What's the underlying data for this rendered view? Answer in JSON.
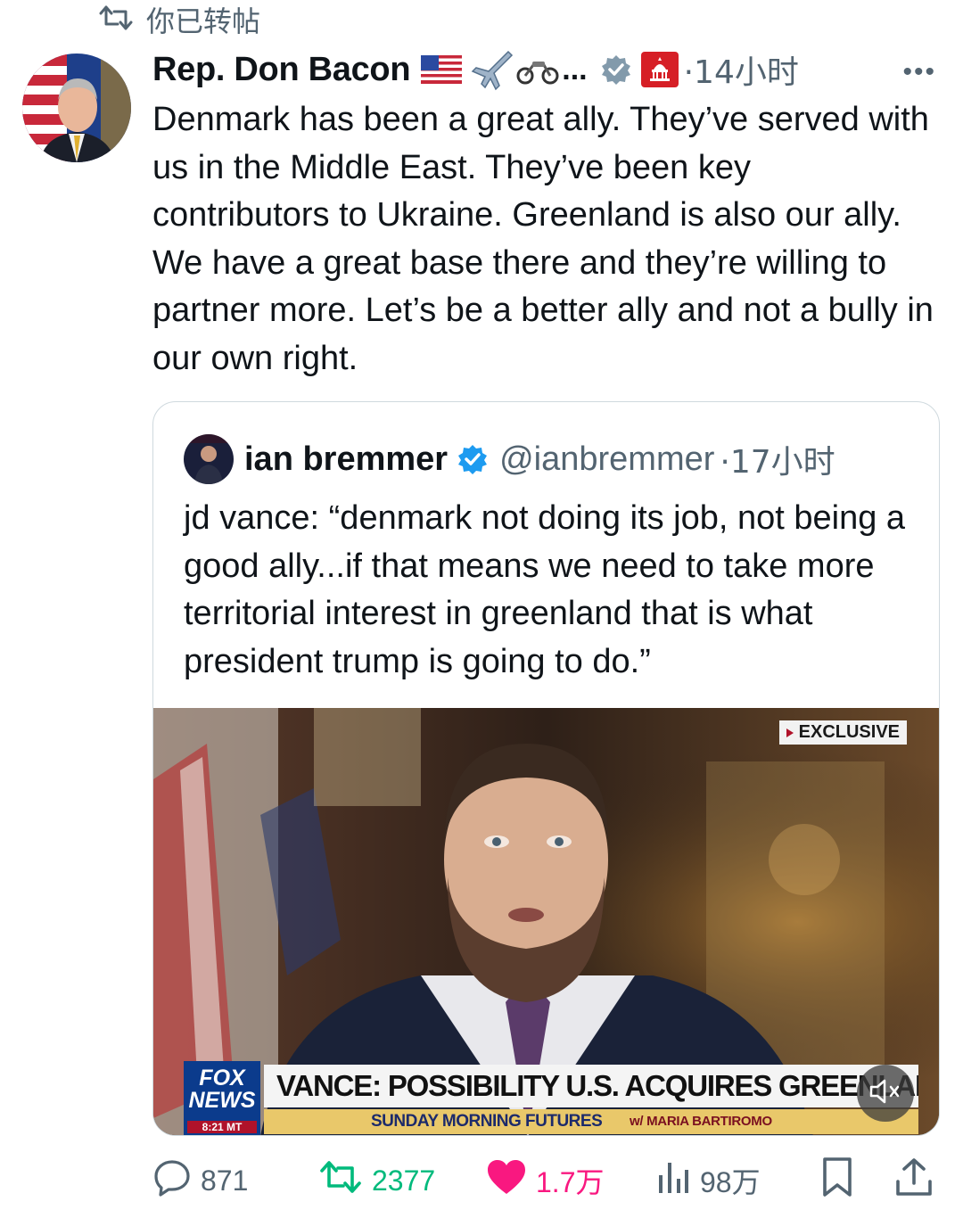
{
  "repost_banner": {
    "label": "你已转帖"
  },
  "tweet": {
    "author_name": "Rep. Don Bacon",
    "author_name_suffix": "...",
    "time_ago": "·14小时",
    "text": "Denmark has been a great ally. They’ve served with us in the Middle East. They’ve been key contributors to Ukraine. Greenland is also our ally. We have a great base there and they’re willing to partner more. Let’s be a better ally and not a bully in our own right.",
    "icons": [
      "us-flag-icon",
      "airplane-icon",
      "motorcycle-icon",
      "gray-verified-badge-icon",
      "gop-capitol-badge-icon"
    ]
  },
  "quoted": {
    "author_name": "ian bremmer",
    "handle": "@ianbremmer",
    "time_ago": "·17小时",
    "text": "jd vance: “denmark not doing its job, not being a good ally...if that means we need to take more territorial interest in greenland that is what president trump is going to do.”",
    "video": {
      "exclusive_tag": "EXCLUSIVE",
      "logo_line1": "FOX",
      "logo_line2": "NEWS",
      "clock": "8:21 MT",
      "headline": "VANCE: POSSIBILITY U.S. ACQUIRES GREENLAND",
      "show_name": "SUNDAY MORNING FUTURES",
      "show_host": "w/ MARIA BARTIROMO"
    }
  },
  "actions": {
    "replies": "871",
    "reposts": "2377",
    "likes": "1.7万",
    "views": "98万"
  },
  "colors": {
    "text_primary": "#0f1419",
    "text_secondary": "#536471",
    "repost_green": "#00ba7c",
    "like_pink": "#f91880",
    "verified_blue": "#1d9bf0"
  }
}
